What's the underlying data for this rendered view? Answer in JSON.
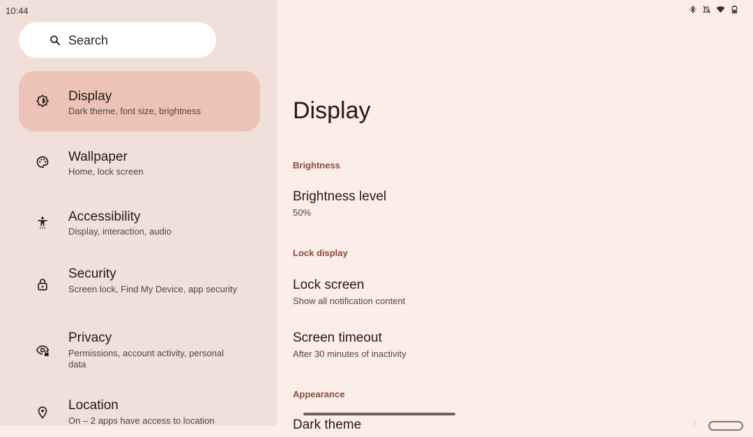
{
  "status_bar": {
    "time": "10:44",
    "icons": [
      "bluetooth-icon",
      "notifications-off-icon",
      "wifi-icon",
      "battery-icon"
    ]
  },
  "search": {
    "label": "Search",
    "icon": "search-icon"
  },
  "sidebar": {
    "items": [
      {
        "title": "Display",
        "subtitle": "Dark theme, font size, brightness",
        "icon": "brightness-icon",
        "selected": true
      },
      {
        "title": "Wallpaper",
        "subtitle": "Home, lock screen",
        "icon": "palette-icon",
        "selected": false
      },
      {
        "title": "Accessibility",
        "subtitle": "Display, interaction, audio",
        "icon": "accessibility-icon",
        "selected": false
      },
      {
        "title": "Security",
        "subtitle": "Screen lock, Find My Device, app security",
        "icon": "lock-icon",
        "selected": false
      },
      {
        "title": "Privacy",
        "subtitle": "Permissions, account activity, personal data",
        "icon": "privacy-eye-icon",
        "selected": false
      },
      {
        "title": "Location",
        "subtitle": "On – 2 apps have access to location",
        "icon": "location-pin-icon",
        "selected": false
      }
    ]
  },
  "main": {
    "title": "Display",
    "sections": {
      "brightness": "Brightness",
      "lock_display": "Lock display",
      "appearance": "Appearance"
    },
    "prefs": {
      "brightness_level": {
        "title": "Brightness level",
        "summary": "50%"
      },
      "lock_screen": {
        "title": "Lock screen",
        "summary": "Show all notification content"
      },
      "screen_timeout": {
        "title": "Screen timeout",
        "summary": "After 30 minutes of inactivity"
      },
      "dark_theme": {
        "title": "Dark theme"
      }
    }
  },
  "colors": {
    "sidebar_bg": "#f1e0da",
    "main_bg": "#fbeee9",
    "selected_bg": "#eec3b7",
    "section_header": "#8b4a3c"
  }
}
